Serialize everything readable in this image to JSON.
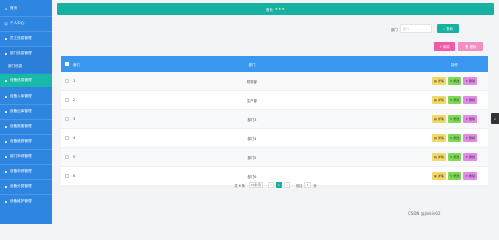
{
  "sidebar": {
    "items": [
      {
        "label": "首页",
        "icon": "home-icon",
        "level": "top"
      },
      {
        "label": "个人中心",
        "icon": "user-icon",
        "level": "top"
      },
      {
        "label": "员工信息管理",
        "icon": "folder-icon",
        "level": "top"
      },
      {
        "label": "部门信息管理",
        "icon": "folder-icon",
        "level": "parent"
      },
      {
        "label": "部门信息",
        "icon": "",
        "level": "sub"
      },
      {
        "label": "设备信息管理",
        "icon": "folder-icon",
        "level": "active"
      },
      {
        "label": "设备入库管理",
        "icon": "folder-icon",
        "level": "top"
      },
      {
        "label": "设备出库管理",
        "icon": "folder-icon",
        "level": "top"
      },
      {
        "label": "设备报废管理",
        "icon": "folder-icon",
        "level": "top"
      },
      {
        "label": "设备维修管理",
        "icon": "folder-icon",
        "level": "top"
      },
      {
        "label": "部门申领管理",
        "icon": "folder-icon",
        "level": "top"
      },
      {
        "label": "设备申领管理",
        "icon": "folder-icon",
        "level": "top"
      },
      {
        "label": "设备分类管理",
        "icon": "folder-icon",
        "level": "top"
      },
      {
        "label": "设备维护管理",
        "icon": "folder-icon",
        "level": "top"
      }
    ]
  },
  "topbar": {
    "title": "首页",
    "stars": "★★★"
  },
  "search": {
    "label": "部门",
    "placeholder": "部门",
    "button": "查询"
  },
  "actions": {
    "add": "+ 新增",
    "delete": "删除"
  },
  "table": {
    "headers": {
      "index": "索引",
      "dept": "部门",
      "ops": "操作"
    },
    "ops": {
      "view": "详情",
      "edit": "修改",
      "remove": "删除"
    },
    "rows": [
      {
        "index": "1",
        "dept": "财务部"
      },
      {
        "index": "2",
        "dept": "生产部"
      },
      {
        "index": "3",
        "dept": "部门3"
      },
      {
        "index": "4",
        "dept": "部门4"
      },
      {
        "index": "5",
        "dept": "部门5"
      },
      {
        "index": "6",
        "dept": "部门6"
      }
    ]
  },
  "pagination": {
    "total": "共 6 条",
    "page_size": "10条/页",
    "prev": "<",
    "current": "1",
    "next": ">",
    "goto_label": "前往",
    "goto_value": "1",
    "page_unit": "页"
  },
  "side_tab": "<",
  "watermark": "CSDN @jinkin02",
  "colors": {
    "sidebar": "#2e86e0",
    "active": "#17b9a8",
    "header": "#3a97f0",
    "view": "#f2d864",
    "edit": "#7ed957",
    "remove": "#e18be6",
    "add": "#f05aa6"
  }
}
